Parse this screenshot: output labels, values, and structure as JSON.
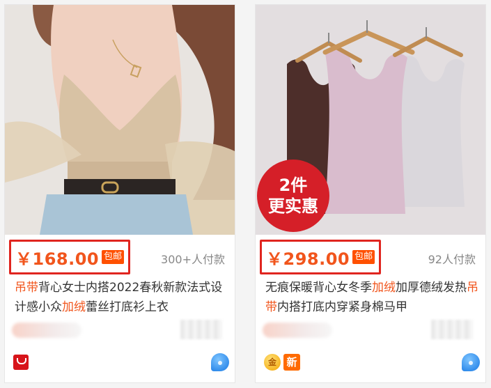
{
  "products": [
    {
      "price": "￥168.00",
      "shipping_label": "包邮",
      "sales": "300+人付款",
      "title_parts": [
        {
          "text": "吊带",
          "hl": true
        },
        {
          "text": "背心女士内搭2022春秋新款法式设计感小众",
          "hl": false
        },
        {
          "text": "加绒",
          "hl": true
        },
        {
          "text": "蕾丝打底衫上衣",
          "hl": false
        }
      ],
      "shop_icon": "shop-logo-icon",
      "service_icon": "chat-bubble-icon"
    },
    {
      "price": "￥298.00",
      "shipping_label": "包邮",
      "sales": "92人付款",
      "promo_line1": "2件",
      "promo_line2": "更实惠",
      "title_parts": [
        {
          "text": "无痕保暖背心女冬季",
          "hl": false
        },
        {
          "text": "加绒",
          "hl": true
        },
        {
          "text": "加厚德绒发热",
          "hl": false
        },
        {
          "text": "吊带",
          "hl": true
        },
        {
          "text": "内搭打底内穿紧身棉马甲",
          "hl": false
        }
      ],
      "badge_gold": "金",
      "badge_new": "新",
      "service_icon": "chat-bubble-icon"
    }
  ],
  "colors": {
    "price": "#f1551c",
    "highlight_box": "#e0251f",
    "shipping_bg": "#ff5000",
    "promo_bg": "#d51f28"
  }
}
